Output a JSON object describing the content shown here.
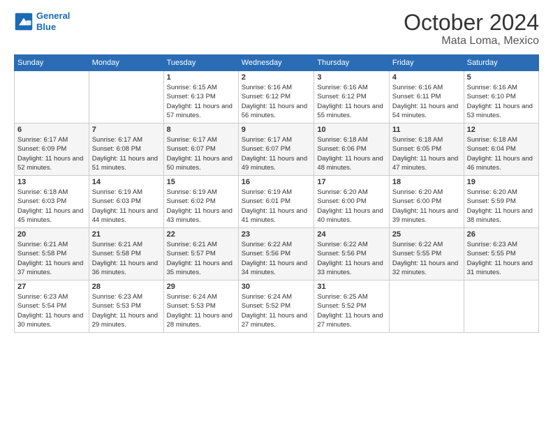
{
  "logo": {
    "line1": "General",
    "line2": "Blue"
  },
  "title": "October 2024",
  "subtitle": "Mata Loma, Mexico",
  "days_of_week": [
    "Sunday",
    "Monday",
    "Tuesday",
    "Wednesday",
    "Thursday",
    "Friday",
    "Saturday"
  ],
  "weeks": [
    [
      {
        "day": "",
        "info": ""
      },
      {
        "day": "",
        "info": ""
      },
      {
        "day": "1",
        "info": "Sunrise: 6:15 AM\nSunset: 6:13 PM\nDaylight: 11 hours and 57 minutes."
      },
      {
        "day": "2",
        "info": "Sunrise: 6:16 AM\nSunset: 6:12 PM\nDaylight: 11 hours and 56 minutes."
      },
      {
        "day": "3",
        "info": "Sunrise: 6:16 AM\nSunset: 6:12 PM\nDaylight: 11 hours and 55 minutes."
      },
      {
        "day": "4",
        "info": "Sunrise: 6:16 AM\nSunset: 6:11 PM\nDaylight: 11 hours and 54 minutes."
      },
      {
        "day": "5",
        "info": "Sunrise: 6:16 AM\nSunset: 6:10 PM\nDaylight: 11 hours and 53 minutes."
      }
    ],
    [
      {
        "day": "6",
        "info": "Sunrise: 6:17 AM\nSunset: 6:09 PM\nDaylight: 11 hours and 52 minutes."
      },
      {
        "day": "7",
        "info": "Sunrise: 6:17 AM\nSunset: 6:08 PM\nDaylight: 11 hours and 51 minutes."
      },
      {
        "day": "8",
        "info": "Sunrise: 6:17 AM\nSunset: 6:07 PM\nDaylight: 11 hours and 50 minutes."
      },
      {
        "day": "9",
        "info": "Sunrise: 6:17 AM\nSunset: 6:07 PM\nDaylight: 11 hours and 49 minutes."
      },
      {
        "day": "10",
        "info": "Sunrise: 6:18 AM\nSunset: 6:06 PM\nDaylight: 11 hours and 48 minutes."
      },
      {
        "day": "11",
        "info": "Sunrise: 6:18 AM\nSunset: 6:05 PM\nDaylight: 11 hours and 47 minutes."
      },
      {
        "day": "12",
        "info": "Sunrise: 6:18 AM\nSunset: 6:04 PM\nDaylight: 11 hours and 46 minutes."
      }
    ],
    [
      {
        "day": "13",
        "info": "Sunrise: 6:18 AM\nSunset: 6:03 PM\nDaylight: 11 hours and 45 minutes."
      },
      {
        "day": "14",
        "info": "Sunrise: 6:19 AM\nSunset: 6:03 PM\nDaylight: 11 hours and 44 minutes."
      },
      {
        "day": "15",
        "info": "Sunrise: 6:19 AM\nSunset: 6:02 PM\nDaylight: 11 hours and 43 minutes."
      },
      {
        "day": "16",
        "info": "Sunrise: 6:19 AM\nSunset: 6:01 PM\nDaylight: 11 hours and 41 minutes."
      },
      {
        "day": "17",
        "info": "Sunrise: 6:20 AM\nSunset: 6:00 PM\nDaylight: 11 hours and 40 minutes."
      },
      {
        "day": "18",
        "info": "Sunrise: 6:20 AM\nSunset: 6:00 PM\nDaylight: 11 hours and 39 minutes."
      },
      {
        "day": "19",
        "info": "Sunrise: 6:20 AM\nSunset: 5:59 PM\nDaylight: 11 hours and 38 minutes."
      }
    ],
    [
      {
        "day": "20",
        "info": "Sunrise: 6:21 AM\nSunset: 5:58 PM\nDaylight: 11 hours and 37 minutes."
      },
      {
        "day": "21",
        "info": "Sunrise: 6:21 AM\nSunset: 5:58 PM\nDaylight: 11 hours and 36 minutes."
      },
      {
        "day": "22",
        "info": "Sunrise: 6:21 AM\nSunset: 5:57 PM\nDaylight: 11 hours and 35 minutes."
      },
      {
        "day": "23",
        "info": "Sunrise: 6:22 AM\nSunset: 5:56 PM\nDaylight: 11 hours and 34 minutes."
      },
      {
        "day": "24",
        "info": "Sunrise: 6:22 AM\nSunset: 5:56 PM\nDaylight: 11 hours and 33 minutes."
      },
      {
        "day": "25",
        "info": "Sunrise: 6:22 AM\nSunset: 5:55 PM\nDaylight: 11 hours and 32 minutes."
      },
      {
        "day": "26",
        "info": "Sunrise: 6:23 AM\nSunset: 5:55 PM\nDaylight: 11 hours and 31 minutes."
      }
    ],
    [
      {
        "day": "27",
        "info": "Sunrise: 6:23 AM\nSunset: 5:54 PM\nDaylight: 11 hours and 30 minutes."
      },
      {
        "day": "28",
        "info": "Sunrise: 6:23 AM\nSunset: 5:53 PM\nDaylight: 11 hours and 29 minutes."
      },
      {
        "day": "29",
        "info": "Sunrise: 6:24 AM\nSunset: 5:53 PM\nDaylight: 11 hours and 28 minutes."
      },
      {
        "day": "30",
        "info": "Sunrise: 6:24 AM\nSunset: 5:52 PM\nDaylight: 11 hours and 27 minutes."
      },
      {
        "day": "31",
        "info": "Sunrise: 6:25 AM\nSunset: 5:52 PM\nDaylight: 11 hours and 27 minutes."
      },
      {
        "day": "",
        "info": ""
      },
      {
        "day": "",
        "info": ""
      }
    ]
  ]
}
